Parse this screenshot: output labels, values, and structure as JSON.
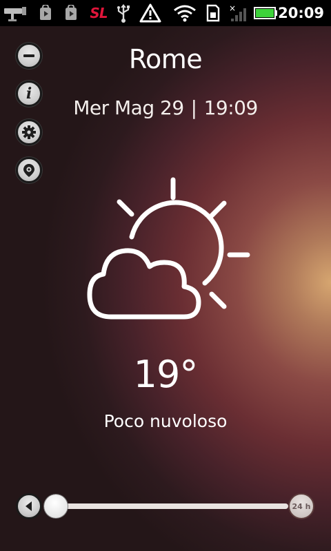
{
  "status_bar": {
    "time": "20:09",
    "carrier_logo_text": "SL",
    "icons": [
      "camera-icon",
      "play-store-icon",
      "play-store-icon",
      "sl-app-icon",
      "usb-icon",
      "warning-icon",
      "wifi-icon",
      "sd-card-icon",
      "no-signal-icon",
      "battery-icon"
    ],
    "accent_red": "#e0153a",
    "battery_color": "#3ed23b"
  },
  "sidebar": {
    "buttons": [
      {
        "icon": "minus-icon"
      },
      {
        "icon": "info-icon",
        "glyph": "i"
      },
      {
        "icon": "gear-icon"
      },
      {
        "icon": "location-pin-icon"
      }
    ]
  },
  "weather": {
    "city": "Rome",
    "date": "Mer Mag 29",
    "separator": "|",
    "time": "19:09",
    "icon": "partly-cloudy-icon",
    "temperature": "19°",
    "condition": "Poco nuvoloso"
  },
  "timeline": {
    "end_label": "24 h",
    "position": 0
  }
}
